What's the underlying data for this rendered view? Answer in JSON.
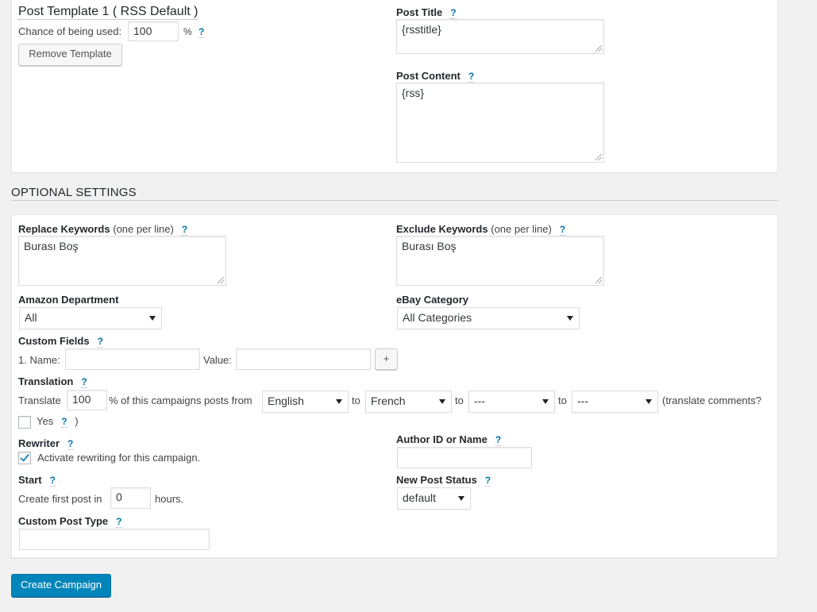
{
  "template": {
    "title": "Post Template 1 ( RSS Default )",
    "chance_label": "Chance of being used:",
    "chance_value": "100",
    "percent": "%",
    "remove_button": "Remove Template",
    "post_title_label": "Post Title",
    "post_title_value": "{rsstitle}",
    "post_content_label": "Post Content",
    "post_content_value": "{rss}"
  },
  "help": "?",
  "optional": {
    "heading": "OPTIONAL SETTINGS",
    "replace_label": "Replace Keywords",
    "replace_sub": "(one per line)",
    "replace_value": "Burası Boş",
    "exclude_label": "Exclude Keywords",
    "exclude_sub": "(one per line)",
    "exclude_value": "Burası Boş",
    "amazon_label": "Amazon Department",
    "amazon_selected": "All",
    "ebay_label": "eBay Category",
    "ebay_selected": "All Categories",
    "custom_fields_label": "Custom Fields",
    "cf_name_label": "1. Name:",
    "cf_value_label": "Value:",
    "cf_add_button": "+",
    "translation_label": "Translation",
    "translate_prefix": "Translate",
    "translate_value": "100",
    "translate_mid": "% of this campaigns posts from",
    "from_lang": "English",
    "to_1": "to",
    "lang_2": "French",
    "to_2": "to",
    "lang_3": "---",
    "to_3": "to",
    "lang_4": "---",
    "translate_comments": "(translate comments?",
    "yes_label": "Yes",
    "close_paren": ")",
    "rewriter_label": "Rewriter",
    "rewriter_text": "Activate rewriting for this campaign.",
    "author_label": "Author ID or Name",
    "author_value": "",
    "start_label": "Start",
    "start_prefix": "Create first post in",
    "start_value": "0",
    "start_suffix": "hours.",
    "status_label": "New Post Status",
    "status_selected": "default",
    "cpt_label": "Custom Post Type",
    "cpt_value": ""
  },
  "create_button": "Create Campaign",
  "colors": {
    "accent": "#0073aa",
    "primary_button": "#0085ba",
    "background": "#f1f1f1"
  }
}
